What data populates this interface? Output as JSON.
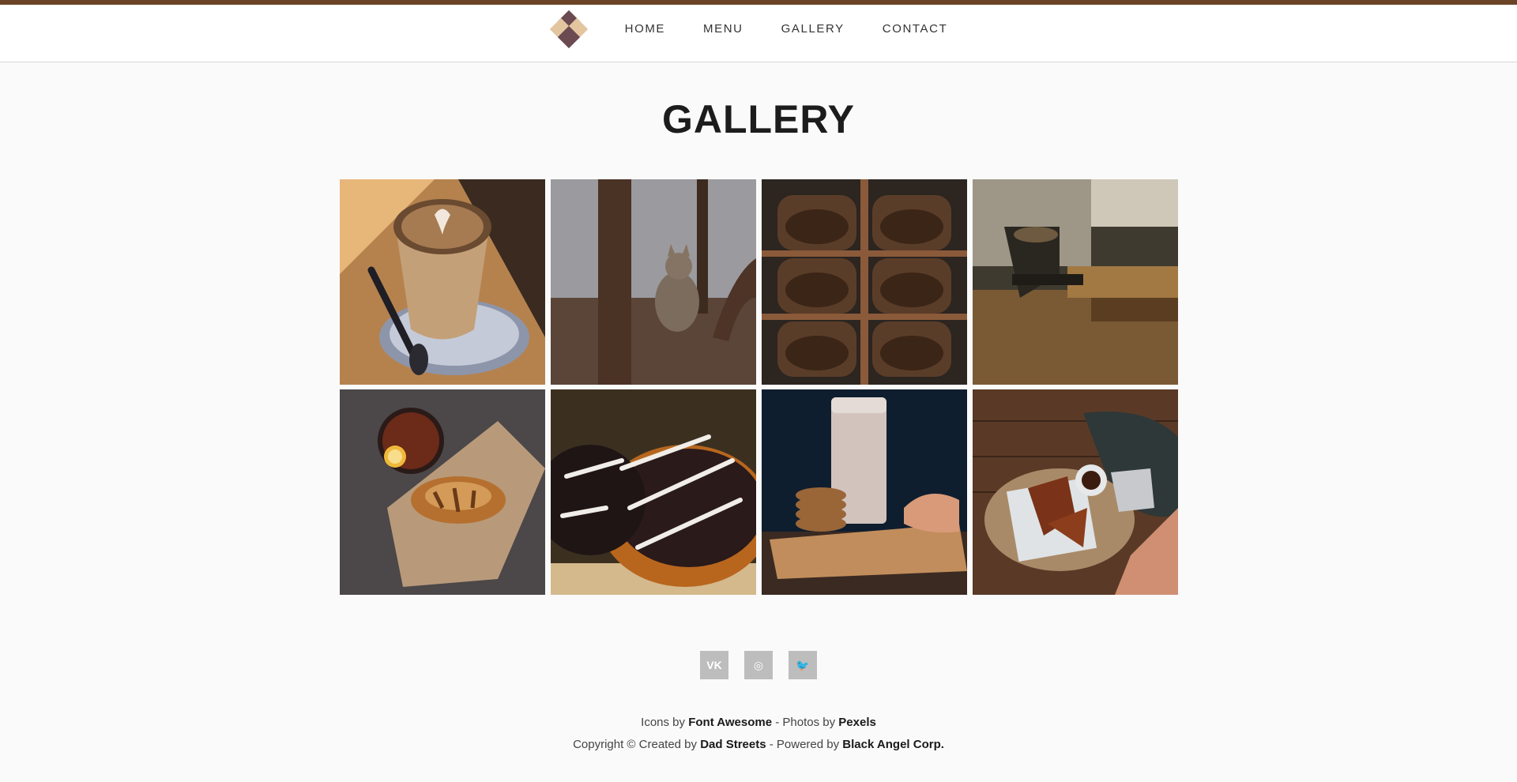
{
  "nav": {
    "items": [
      {
        "label": "HOME"
      },
      {
        "label": "MENU"
      },
      {
        "label": "GALLERY"
      },
      {
        "label": "CONTACT"
      }
    ]
  },
  "page": {
    "title": "GALLERY"
  },
  "gallery": {
    "photos": [
      {
        "subject": "latte with saucer and spoon"
      },
      {
        "subject": "cat sitting by chair"
      },
      {
        "subject": "coffee bean bags"
      },
      {
        "subject": "espresso machine"
      },
      {
        "subject": "tea with croissant"
      },
      {
        "subject": "chocolate donuts"
      },
      {
        "subject": "milk with cookies"
      },
      {
        "subject": "waffles and coffee pot"
      }
    ]
  },
  "social": [
    {
      "name": "vk-icon",
      "glyph": "VK"
    },
    {
      "name": "instagram-icon",
      "glyph": "◎"
    },
    {
      "name": "twitter-icon",
      "glyph": "🐦"
    }
  ],
  "footer": {
    "icons_prefix": "Icons by",
    "icons_source": "Font Awesome",
    "photos_prefix": "- Photos by",
    "photos_source": "Pexels",
    "copyright_prefix": "Copyright © Created by",
    "author": "Dad Streets",
    "powered_prefix": "- Powered by",
    "company": "Black Angel Corp."
  },
  "colors": {
    "top_border": "#6b4428",
    "logo_dark": "#6b4a52",
    "logo_light": "#e3c59f",
    "social_bg": "#bdbdbd"
  }
}
